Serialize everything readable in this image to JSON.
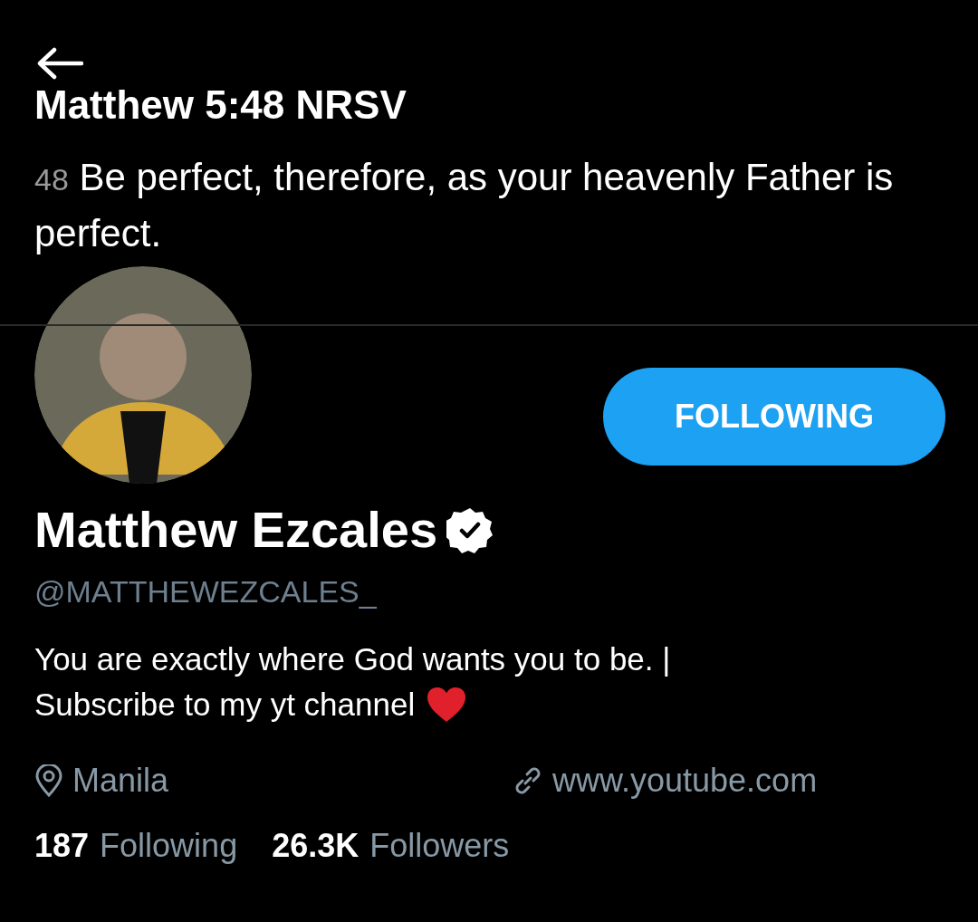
{
  "banner": {
    "title": "Matthew 5:48 NRSV",
    "verse_number": "48",
    "verse_text": "Be perfect, therefore, as your heavenly Father is perfect."
  },
  "profile": {
    "follow_button": "FOLLOWING",
    "name": "Matthew Ezcales",
    "verified": true,
    "handle": "@MATTHEWEZCALES_",
    "bio_lines": [
      "You are exactly where God wants you to be. |",
      "Subscribe to my yt channel"
    ],
    "location": "Manila",
    "website": "www.youtube.com"
  },
  "stats": [
    {
      "count": "187",
      "label": "Following"
    },
    {
      "count": "26.3K",
      "label": "Followers"
    }
  ]
}
